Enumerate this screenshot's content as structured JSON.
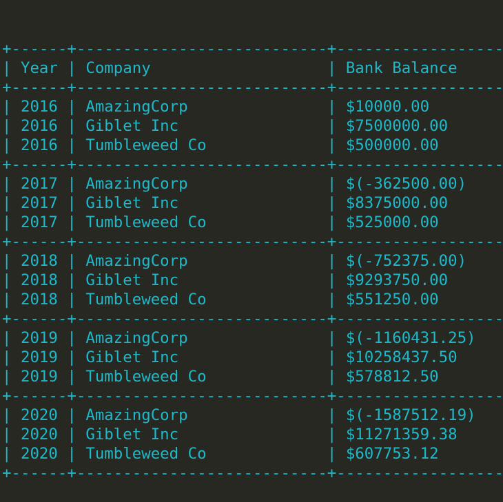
{
  "table": {
    "widths": {
      "year": 4,
      "company": 25,
      "balance": 17
    },
    "headers": {
      "year": "Year",
      "company": "Company",
      "balance": "Bank Balance"
    },
    "groups": [
      [
        {
          "year": "2016",
          "company": "AmazingCorp",
          "balance": "$10000.00"
        },
        {
          "year": "2016",
          "company": "Giblet Inc",
          "balance": "$7500000.00"
        },
        {
          "year": "2016",
          "company": "Tumbleweed Co",
          "balance": "$500000.00"
        }
      ],
      [
        {
          "year": "2017",
          "company": "AmazingCorp",
          "balance": "$(-362500.00)"
        },
        {
          "year": "2017",
          "company": "Giblet Inc",
          "balance": "$8375000.00"
        },
        {
          "year": "2017",
          "company": "Tumbleweed Co",
          "balance": "$525000.00"
        }
      ],
      [
        {
          "year": "2018",
          "company": "AmazingCorp",
          "balance": "$(-752375.00)"
        },
        {
          "year": "2018",
          "company": "Giblet Inc",
          "balance": "$9293750.00"
        },
        {
          "year": "2018",
          "company": "Tumbleweed Co",
          "balance": "$551250.00"
        }
      ],
      [
        {
          "year": "2019",
          "company": "AmazingCorp",
          "balance": "$(-1160431.25)"
        },
        {
          "year": "2019",
          "company": "Giblet Inc",
          "balance": "$10258437.50"
        },
        {
          "year": "2019",
          "company": "Tumbleweed Co",
          "balance": "$578812.50"
        }
      ],
      [
        {
          "year": "2020",
          "company": "AmazingCorp",
          "balance": "$(-1587512.19)"
        },
        {
          "year": "2020",
          "company": "Giblet Inc",
          "balance": "$11271359.38"
        },
        {
          "year": "2020",
          "company": "Tumbleweed Co",
          "balance": "$607753.12"
        }
      ]
    ]
  },
  "colors": {
    "background": "#272822",
    "text": "#1fb8c9"
  }
}
